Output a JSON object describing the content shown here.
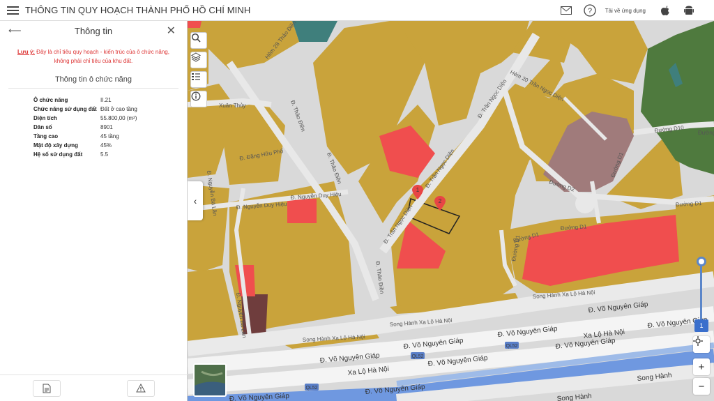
{
  "app": {
    "title": "THÔNG TIN QUY HOẠCH THÀNH PHỐ HỒ CHÍ MINH",
    "download_label": "Tải về ứng dụng"
  },
  "icons": {
    "menu": "hamburger-icon",
    "mail": "mail-icon",
    "help": "help-icon",
    "apple": "apple-icon",
    "android": "android-icon"
  },
  "panel": {
    "title": "Thông tin",
    "note_prefix": "Lưu ý:",
    "note_text": " Đây là chỉ tiêu quy hoạch - kiến trúc của ô chức năng, không phải chỉ tiêu của khu đất.",
    "section_title": "Thông tin ô chức năng",
    "rows": [
      {
        "key": "Ô chức năng",
        "value": "II.21"
      },
      {
        "key": "Chức năng sử dụng đất",
        "value": "Đất ở cao tầng"
      },
      {
        "key": "Diện tích",
        "value": "55.800,00 (m²)"
      },
      {
        "key": "Dân số",
        "value": "8901"
      },
      {
        "key": "Tầng cao",
        "value": "45 tầng"
      },
      {
        "key": "Mật độ xây dựng",
        "value": "45%"
      },
      {
        "key": "Hệ số sử dụng đất",
        "value": "5.5"
      }
    ]
  },
  "map": {
    "marker_1": "1",
    "marker_2": "2",
    "zoom_level": "1",
    "streets": {
      "hem28": "Hẻm 28 Thảo Điền",
      "xuanthuy": "Xuân Thủy",
      "thaodien1": "Đ. Thảo Điền",
      "thaodien2": "Đ. Thảo Điền",
      "thaodien3": "Đ. Thảo Điền",
      "dangchulphu": "Đ. Đặng Hữu Phổ",
      "nguyenduyhieu1": "Đ. Nguyễn Duy Hiệu",
      "nguyenduyhieu2": "Đ. Nguyễn Duy Hiệu",
      "nguyenbalan1": "Đ. Nguyễn Bá Lân",
      "nguyenbalan2": "Đ. Nguyễn Bá Lân",
      "tranngocdien1": "Đ. Trần Ngọc Diện",
      "tranngocdien2": "Đ. Trần Ngọc Diện",
      "tranngocdien3": "Đ. Trần Ngọc Diện",
      "hem20": "Hẻm 20 Trần Ngọc Diện",
      "duongd10a": "Đường D10",
      "duongd10b": "Đường",
      "duongd1a": "Đường D1",
      "duongd1b": "Đường D1",
      "duongd1c": "Đường D1",
      "duongd1d": "Đường D1",
      "duongd2": "Đường D2",
      "duongd1e": "Đường D1",
      "songhanh1": "Song Hành Xa Lộ Hà Nội",
      "songhanh2": "Song Hành Xa Lộ Hà Nội",
      "songhanh3": "Song Hành Xa Lộ Hà Nội",
      "vng1": "Đ. Võ Nguyên Giáp",
      "vng2": "Đ. Võ Nguyên Giáp",
      "vng3": "Đ. Võ Nguyên Giáp",
      "vng4": "Đ. Võ Nguyên Giáp",
      "vng5": "Đ. Võ Nguyên Giáp",
      "vng6": "Đ. Võ Nguyên Giáp",
      "vng7": "Đ. Võ Nguyên Giáp",
      "xalo1": "Xa Lộ Hà Nội",
      "xalo2": "Xa Lộ Hà Nội",
      "ql52a": "QL52",
      "ql52b": "QL52",
      "ql52c": "QL52",
      "songhanh4": "Song Hành",
      "songhanh5": "Song Hành"
    }
  },
  "colors": {
    "residential": "#c9a33b",
    "commercial": "#f04e4e",
    "public": "#a07b7b",
    "green": "#4f7a3e",
    "water": "#3f7f7c"
  }
}
